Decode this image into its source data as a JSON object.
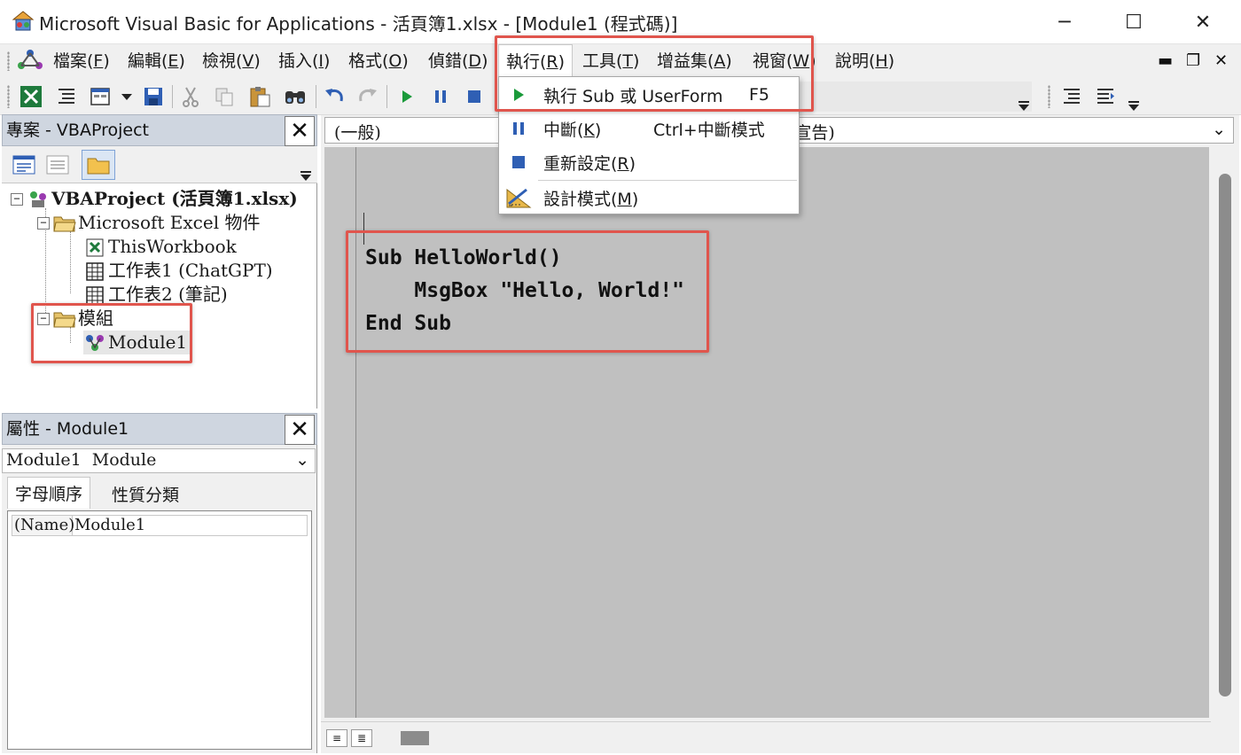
{
  "window": {
    "title": "Microsoft Visual Basic for Applications - 活頁簿1.xlsx - [Module1 (程式碼)]",
    "minimize_glyph": "─",
    "maximize_glyph": "☐",
    "close_glyph": "✕"
  },
  "menubar": {
    "items": [
      {
        "pre": "檔案(",
        "key": "F",
        "post": ")"
      },
      {
        "pre": "編輯(",
        "key": "E",
        "post": ")"
      },
      {
        "pre": "檢視(",
        "key": "V",
        "post": ")"
      },
      {
        "pre": "插入(",
        "key": "I",
        "post": ")"
      },
      {
        "pre": "格式(",
        "key": "O",
        "post": ")"
      },
      {
        "pre": "偵錯(",
        "key": "D",
        "post": ")"
      },
      {
        "pre": "執行(",
        "key": "R",
        "post": ")"
      },
      {
        "pre": "工具(",
        "key": "T",
        "post": ")"
      },
      {
        "pre": "增益集(",
        "key": "A",
        "post": ")"
      },
      {
        "pre": "視窗(",
        "key": "W",
        "post": ")"
      },
      {
        "pre": "說明(",
        "key": "H",
        "post": ")"
      }
    ],
    "mdi_minimize": "▬",
    "mdi_restore": "❐",
    "mdi_close": "✕"
  },
  "run_menu": {
    "items": [
      {
        "label": "執行 Sub 或 UserForm",
        "shortcut": "F5",
        "icon": "run-icon"
      },
      {
        "pre": "中斷(",
        "key": "K",
        "post": ")",
        "shortcut": "Ctrl+中斷模式",
        "icon": "break-icon"
      },
      {
        "pre": "重新設定(",
        "key": "R",
        "post": ")",
        "shortcut": "",
        "icon": "reset-icon"
      },
      {
        "pre": "設計模式(",
        "key": "M",
        "post": ")",
        "shortcut": "",
        "icon": "design-mode-icon"
      }
    ]
  },
  "project_pane": {
    "title": "專案 - VBAProject",
    "close": "✕",
    "tree": {
      "root": "VBAProject (活頁簿1.xlsx)",
      "excel_objects_folder": "Microsoft Excel 物件",
      "this_workbook": "ThisWorkbook",
      "sheet1": "工作表1 (ChatGPT)",
      "sheet2": "工作表2 (筆記)",
      "modules_folder": "模組",
      "module1": "Module1",
      "expander": "−"
    }
  },
  "properties_pane": {
    "title": "屬性 - Module1",
    "close": "✕",
    "object_name": "Module1",
    "object_type": "Module",
    "dropdown_arrow": "⌄",
    "tab_alphabetic": "字母順序",
    "tab_categorized": "性質分類",
    "row_name_label": "(Name)",
    "row_name_value": "Module1"
  },
  "code_window": {
    "object_combo": "(一般)",
    "procedure_combo": "(宣告)",
    "combo_arrow": "⌄",
    "lines": [
      "Sub HelloWorld()",
      "    MsgBox \"Hello, World!\"",
      "End Sub"
    ],
    "view_procedure": "≡",
    "view_module": "≣"
  },
  "colors": {
    "highlight": "#e0554d",
    "code_bg": "#c0c0c0",
    "pane_header": "#cfd6e0",
    "run_green": "#1a9a3a",
    "toolbar_blue": "#2f5fb4"
  }
}
